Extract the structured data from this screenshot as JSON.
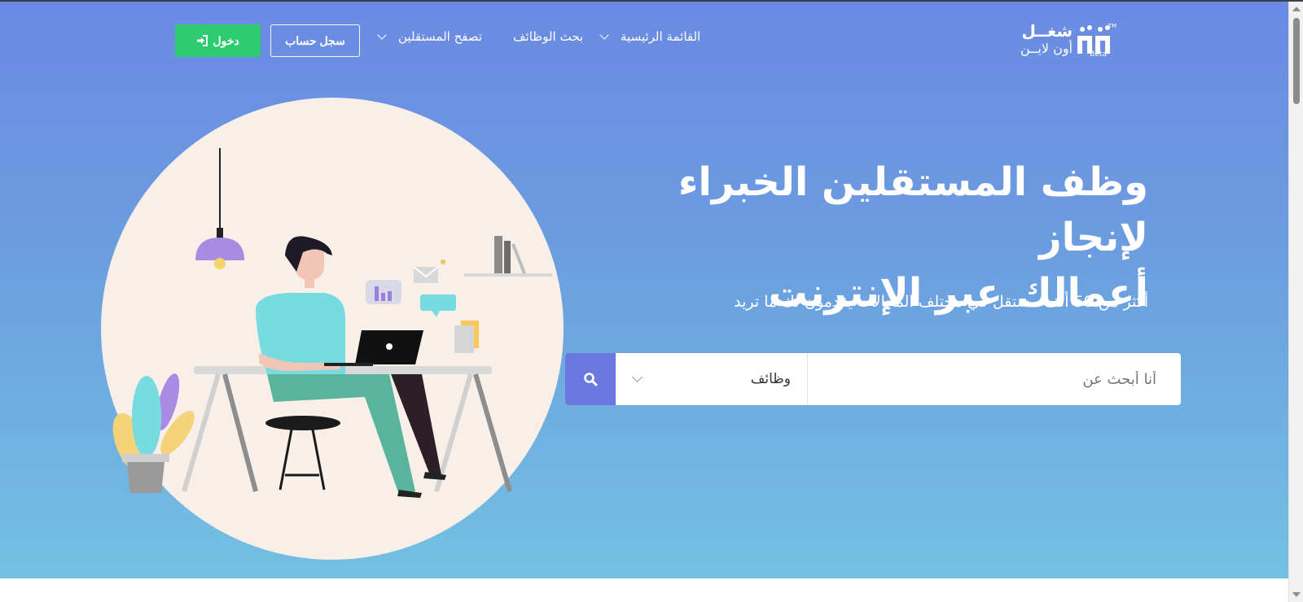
{
  "nav": {
    "login_label": "دخول",
    "register_label": "سجل حساب",
    "items": [
      {
        "label": "القائمة الرئيسية",
        "has_dropdown": true
      },
      {
        "label": "بحث الوظائف",
        "has_dropdown": false
      },
      {
        "label": "تصفح المستقلين",
        "has_dropdown": true
      }
    ]
  },
  "logo": {
    "line1": "شغــل",
    "line2": "أون لايــن",
    "badge": "Beta",
    "mark": "TM"
  },
  "hero": {
    "headline_line1": "وظف المستقلين الخبراء لإنجاز",
    "headline_line2": "أعمالك عبر الإنترنت",
    "subhead": "أكثر من 50 ألف مستقل في مختلف المجالات يقدمون لك ما تريد"
  },
  "search": {
    "placeholder": "أنا أبحث عن",
    "category_selected": "وظائف",
    "button_icon": "search-icon"
  },
  "colors": {
    "accent_green": "#2ecc71",
    "search_button": "#6a78e0",
    "hero_top": "#6a8ae3",
    "hero_bottom": "#73c1e2"
  }
}
